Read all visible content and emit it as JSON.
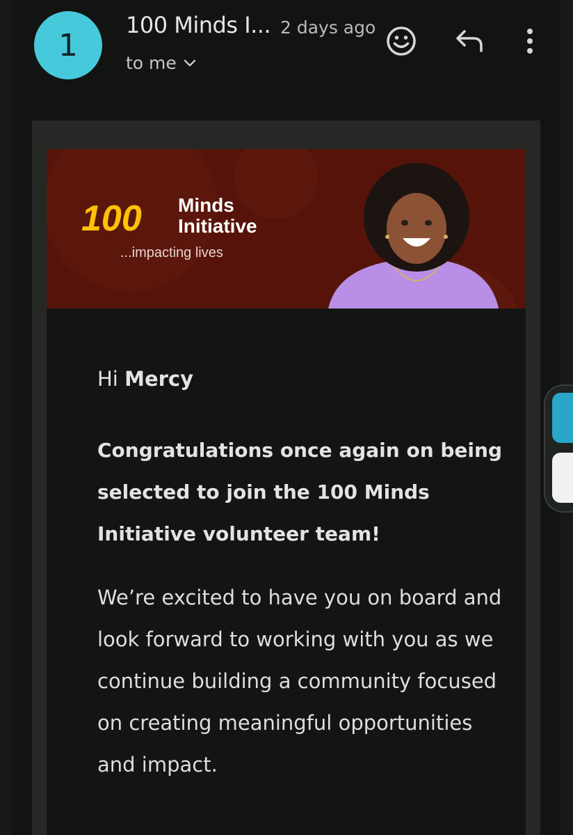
{
  "header": {
    "avatar_initial": "1",
    "sender": "100 Minds I...",
    "time": "2 days ago",
    "recipient": "to me"
  },
  "banner": {
    "logo_number": "100",
    "logo_line1": "Minds",
    "logo_line2": "Initiative",
    "tagline": "...impacting lives"
  },
  "email": {
    "greeting_prefix": "Hi ",
    "greeting_name": "Mercy",
    "congrats": "Congratulations once again on being selected to join the 100 Minds Initiative volunteer team!",
    "paragraph": "We’re excited to have you on board and look forward to working with you as we continue building a community focused on creating meaningful opportunities and impact."
  },
  "icons": {
    "emoji": "emoji-icon",
    "reply": "reply-icon",
    "more": "more-vert-icon",
    "chevron": "chevron-down-icon"
  },
  "colors": {
    "avatar": "#47c9dc",
    "banner": "#551309",
    "logo_yellow": "#ffc107",
    "background": "#121412"
  }
}
